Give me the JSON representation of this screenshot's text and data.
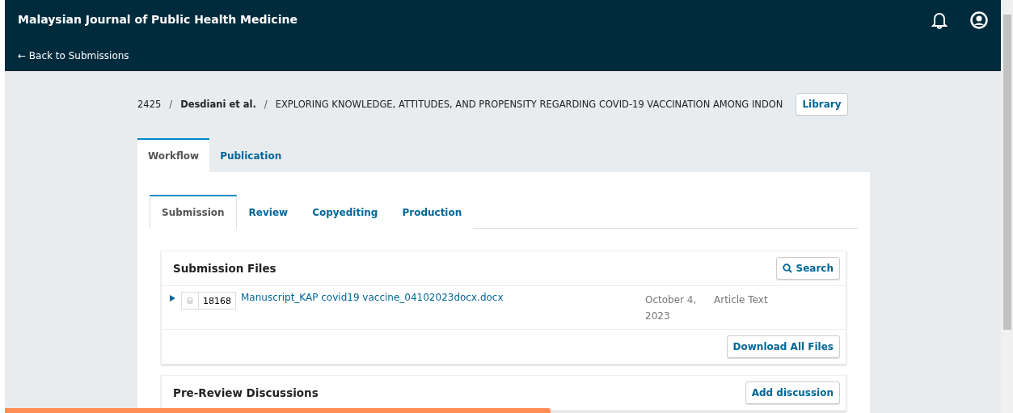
{
  "header": {
    "title": "Malaysian Journal of Public Health Medicine",
    "back_link": "← Back to Submissions"
  },
  "breadcrumb": {
    "id": "2425",
    "separator": "/",
    "authors": "Desdiani et al.",
    "title": "EXPLORING KNOWLEDGE, ATTITUDES, AND PROPENSITY REGARDING COVID-19 VACCINATION AMONG INDON",
    "button": "Library"
  },
  "tabs": [
    {
      "label": "Workflow",
      "selected": true
    },
    {
      "label": "Publication",
      "selected": false
    }
  ],
  "stage_tabs": [
    {
      "label": "Submission",
      "selected": true
    },
    {
      "label": "Review",
      "selected": false
    },
    {
      "label": "Copyediting",
      "selected": false
    },
    {
      "label": "Production",
      "selected": false
    }
  ],
  "submission_files": {
    "title": "Submission Files",
    "search_button": "Search",
    "files": [
      {
        "expanded": false,
        "id": "18168",
        "name": "Manuscript_KAP covid19 vaccine_04102023docx.docx",
        "date": "October 4, 2023",
        "component": "Article Text"
      }
    ],
    "footer_button": "Download All Files"
  },
  "discussions": {
    "title": "Pre-Review Discussions",
    "button": "Add discussion"
  }
}
